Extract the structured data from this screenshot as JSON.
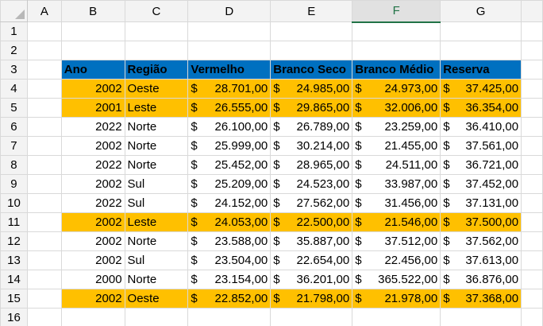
{
  "sheet": {
    "columns": [
      "A",
      "B",
      "C",
      "D",
      "E",
      "F",
      "G"
    ],
    "selected_column": "F",
    "rows": [
      "1",
      "2",
      "3",
      "4",
      "5",
      "6",
      "7",
      "8",
      "9",
      "10",
      "11",
      "12",
      "13",
      "14",
      "15",
      "16"
    ]
  },
  "table": {
    "headers": [
      "Ano",
      "Região",
      "Vermelho",
      "Branco Seco",
      "Branco Médio",
      "Reserva"
    ],
    "currency_symbol": "$",
    "highlight_color": "#ffc000",
    "header_color": "#0070c0",
    "records": [
      {
        "ano": "2002",
        "regiao": "Oeste",
        "vermelho": "28.701,00",
        "branco_seco": "24.985,00",
        "branco_medio": "24.973,00",
        "reserva": "37.425,00",
        "highlight": true
      },
      {
        "ano": "2001",
        "regiao": "Leste",
        "vermelho": "26.555,00",
        "branco_seco": "29.865,00",
        "branco_medio": "32.006,00",
        "reserva": "36.354,00",
        "highlight": true
      },
      {
        "ano": "2022",
        "regiao": "Norte",
        "vermelho": "26.100,00",
        "branco_seco": "26.789,00",
        "branco_medio": "23.259,00",
        "reserva": "36.410,00",
        "highlight": false
      },
      {
        "ano": "2002",
        "regiao": "Norte",
        "vermelho": "25.999,00",
        "branco_seco": "30.214,00",
        "branco_medio": "21.455,00",
        "reserva": "37.561,00",
        "highlight": false
      },
      {
        "ano": "2022",
        "regiao": "Norte",
        "vermelho": "25.452,00",
        "branco_seco": "28.965,00",
        "branco_medio": "24.511,00",
        "reserva": "36.721,00",
        "highlight": false
      },
      {
        "ano": "2002",
        "regiao": "Sul",
        "vermelho": "25.209,00",
        "branco_seco": "24.523,00",
        "branco_medio": "33.987,00",
        "reserva": "37.452,00",
        "highlight": false
      },
      {
        "ano": "2022",
        "regiao": "Sul",
        "vermelho": "24.152,00",
        "branco_seco": "27.562,00",
        "branco_medio": "31.456,00",
        "reserva": "37.131,00",
        "highlight": false
      },
      {
        "ano": "2002",
        "regiao": "Leste",
        "vermelho": "24.053,00",
        "branco_seco": "22.500,00",
        "branco_medio": "21.546,00",
        "reserva": "37.500,00",
        "highlight": true
      },
      {
        "ano": "2002",
        "regiao": "Norte",
        "vermelho": "23.588,00",
        "branco_seco": "35.887,00",
        "branco_medio": "37.512,00",
        "reserva": "37.562,00",
        "highlight": false
      },
      {
        "ano": "2002",
        "regiao": "Sul",
        "vermelho": "23.504,00",
        "branco_seco": "22.654,00",
        "branco_medio": "22.456,00",
        "reserva": "37.613,00",
        "highlight": false
      },
      {
        "ano": "2000",
        "regiao": "Norte",
        "vermelho": "23.154,00",
        "branco_seco": "36.201,00",
        "branco_medio": "365.522,00",
        "reserva": "36.876,00",
        "highlight": false
      },
      {
        "ano": "2002",
        "regiao": "Oeste",
        "vermelho": "22.852,00",
        "branco_seco": "21.798,00",
        "branco_medio": "21.978,00",
        "reserva": "37.368,00",
        "highlight": true
      }
    ]
  }
}
